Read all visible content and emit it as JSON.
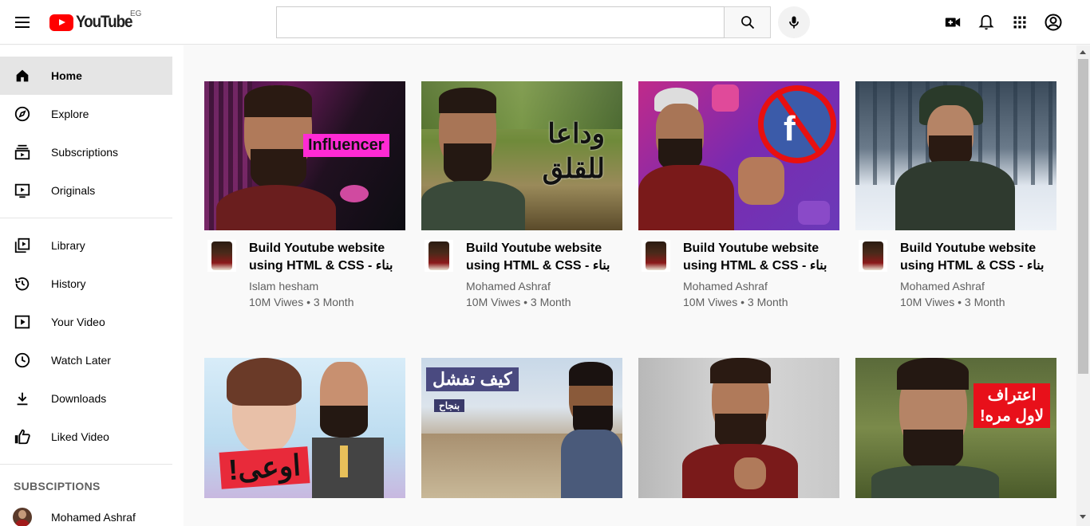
{
  "header": {
    "logo_text": "YouTube",
    "country_code": "EG",
    "search_placeholder": "",
    "icons": [
      "menu-icon",
      "search-icon",
      "mic-icon",
      "create-video-icon",
      "notifications-icon",
      "apps-icon",
      "account-icon"
    ]
  },
  "sidebar": {
    "items": [
      {
        "label": "Home",
        "icon": "home-icon",
        "active": true
      },
      {
        "label": "Explore",
        "icon": "compass-icon"
      },
      {
        "label": "Subscriptions",
        "icon": "subscriptions-icon"
      },
      {
        "label": "Originals",
        "icon": "originals-icon"
      },
      {
        "label": "Library",
        "icon": "library-icon"
      },
      {
        "label": "History",
        "icon": "history-icon"
      },
      {
        "label": "Your Video",
        "icon": "your-video-icon"
      },
      {
        "label": "Watch Later",
        "icon": "clock-icon"
      },
      {
        "label": "Downloads",
        "icon": "download-icon"
      },
      {
        "label": "Liked Video",
        "icon": "thumbs-up-icon"
      }
    ],
    "section_title": "SUBSCIPTIONS",
    "subscriptions": [
      {
        "label": "Mohamed Ashraf"
      }
    ]
  },
  "videos": [
    {
      "title_line1": "Build Youtube website",
      "title_line2": "using HTML & CSS - بناء",
      "channel": "Islam hesham",
      "stats": "10M Viwes • 3 Month",
      "thumb_text": "Influencer"
    },
    {
      "title_line1": "Build Youtube website",
      "title_line2": "using HTML & CSS - بناء",
      "channel": "Mohamed Ashraf",
      "stats": "10M Viwes • 3 Month",
      "thumb_text": "وداعا للقلق"
    },
    {
      "title_line1": "Build Youtube website",
      "title_line2": "using HTML & CSS - بناء",
      "channel": "Mohamed Ashraf",
      "stats": "10M Viwes • 3 Month",
      "thumb_text": ""
    },
    {
      "title_line1": "Build Youtube website",
      "title_line2": "using HTML & CSS - بناء",
      "channel": "Mohamed Ashraf",
      "stats": "10M Viwes • 3 Month",
      "thumb_text": ""
    }
  ],
  "row2_thumbs": [
    {
      "thumb_text": "اوعى!"
    },
    {
      "thumb_text": "كيف تفشل",
      "thumb_subtext": "بنجاح"
    },
    {
      "thumb_text": ""
    },
    {
      "thumb_text": "اعتراف لاول مره!"
    }
  ]
}
